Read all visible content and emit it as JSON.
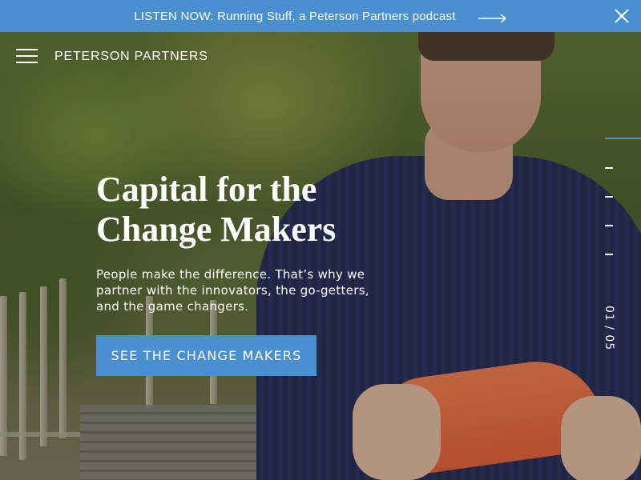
{
  "banner": {
    "text": "LISTEN NOW: Running Stuff, a Peterson Partners podcast",
    "arrow_icon": "arrow-right-icon",
    "close_icon": "close-icon",
    "color": "#4a90d0"
  },
  "header": {
    "menu_icon": "hamburger-menu-icon",
    "logo_part1": "PETERSON",
    "logo_part2": "PARTNERS"
  },
  "hero": {
    "headline_line1": "Capital for the",
    "headline_line2": "Change Makers",
    "subtext": "People make the difference. That’s why we partner with the innovators, the go-getters, and the game changers.",
    "cta_label": "SEE THE CHANGE MAKERS"
  },
  "slider": {
    "current": "01",
    "total": "05",
    "counter": "01 / 05",
    "active_color": "#4a90d0"
  }
}
